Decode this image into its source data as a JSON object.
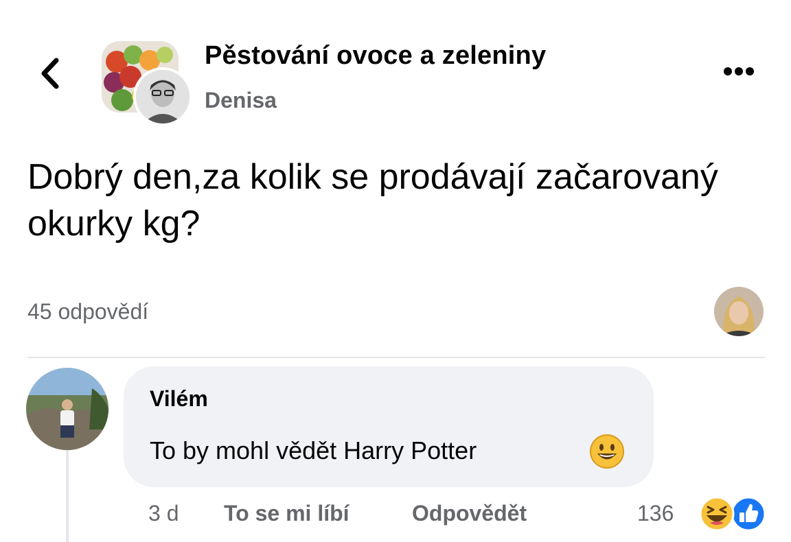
{
  "header": {
    "group_name": "Pěstování ovoce a zeleniny",
    "author_name": "Denisa"
  },
  "post": {
    "text": "Dobrý den,za kolik se prodávají začarovaný okurky kg?",
    "answers_count": "45 odpovědí"
  },
  "comment": {
    "author": "Vilém",
    "text": "To by mohl vědět Harry Potter",
    "time": "3 d",
    "like_label": "To se mi líbí",
    "reply_label": "Odpovědět",
    "reaction_count": "136"
  },
  "icons": {
    "back": "chevron-left-icon",
    "more": "more-dots-icon",
    "emoji": "smiley-emoji-icon",
    "reactions": [
      "haha-reaction-icon",
      "like-reaction-icon"
    ]
  },
  "colors": {
    "text": "#050505",
    "secondary_text": "#65676b",
    "bubble": "#f0f2f5",
    "like_blue": "#1877f2",
    "emoji_yellow": "#f7c13a"
  }
}
